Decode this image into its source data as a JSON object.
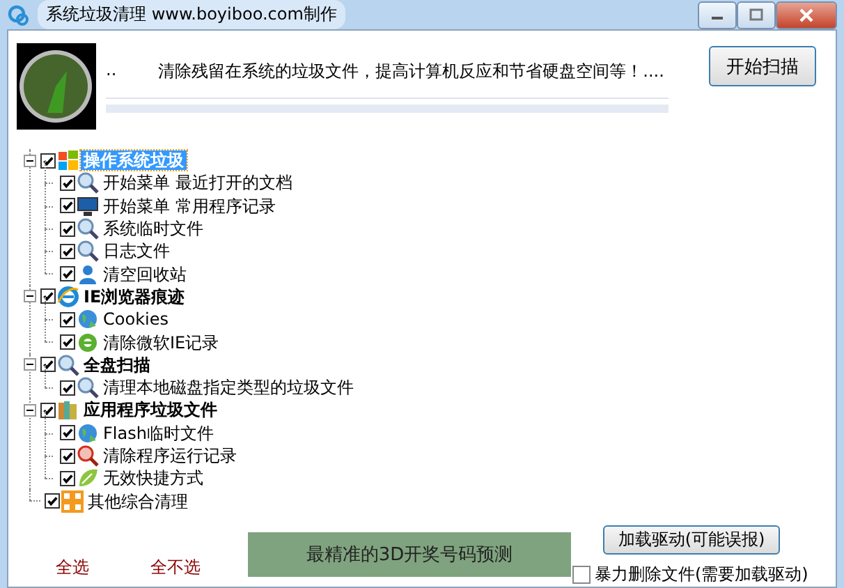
{
  "window": {
    "title": "系统垃圾清理  www.boyiboo.com制作"
  },
  "header": {
    "message_left": "..",
    "message": "清除残留在系统的垃圾文件，提高计算机反应和节省硬盘空间等！....",
    "scan_button": "开始扫描",
    "progress": {
      "level": 0
    }
  },
  "tree": [
    {
      "label": "操作系统垃圾",
      "checked": true,
      "expanded": true,
      "selected": true,
      "children": [
        {
          "label": "开始菜单  最近打开的文档",
          "checked": true
        },
        {
          "label": "开始菜单  常用程序记录",
          "checked": true
        },
        {
          "label": "系统临时文件",
          "checked": true
        },
        {
          "label": "日志文件",
          "checked": true
        },
        {
          "label": "清空回收站",
          "checked": true
        }
      ]
    },
    {
      "label": "IE浏览器痕迹",
      "checked": true,
      "expanded": true,
      "selected": false,
      "children": [
        {
          "label": "Cookies",
          "checked": true
        },
        {
          "label": "清除微软IE记录",
          "checked": true
        }
      ]
    },
    {
      "label": "全盘扫描",
      "checked": true,
      "expanded": true,
      "selected": false,
      "children": [
        {
          "label": "清理本地磁盘指定类型的垃圾文件",
          "checked": true
        }
      ]
    },
    {
      "label": "应用程序垃圾文件",
      "checked": true,
      "expanded": true,
      "selected": false,
      "children": [
        {
          "label": "Flash临时文件",
          "checked": true
        },
        {
          "label": "清除程序运行记录",
          "checked": true
        },
        {
          "label": "无效快捷方式",
          "checked": true
        }
      ]
    },
    {
      "label": "其他综合清理",
      "checked": true,
      "selected": false
    }
  ],
  "footer": {
    "select_all": "全选",
    "select_none": "全不选",
    "banner": "最精准的3D开奖号码预测",
    "driver_button": "加载驱动(可能误报)",
    "force_delete": {
      "label": "暴力删除文件(需要加载驱动)",
      "checked": false
    }
  }
}
